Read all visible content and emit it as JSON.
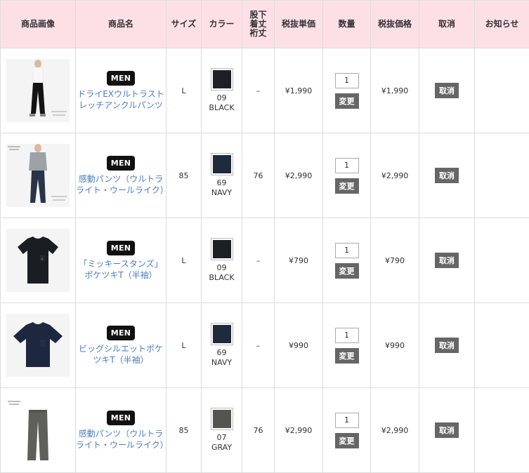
{
  "headers": {
    "image": "商品画像",
    "name": "商品名",
    "size": "サイズ",
    "color": "カラー",
    "inseam": "股下\n着丈\n裄丈",
    "unit_price": "税抜単価",
    "quantity": "数量",
    "price": "税抜価格",
    "cancel": "取消",
    "notice": "お知らせ"
  },
  "labels": {
    "men_badge": "MEN",
    "change_button": "変更",
    "cancel_button": "取消"
  },
  "items": [
    {
      "badge": "MEN",
      "name": "ドライEXウルトラストレッチアンクルパンツ",
      "size": "L",
      "color_code": "09",
      "color_name": "BLACK",
      "swatch_color": "#1d2023",
      "inseam": "–",
      "unit_price": "¥1,990",
      "quantity": "1",
      "price": "¥1,990",
      "image_type": "pants-black"
    },
    {
      "badge": "MEN",
      "name": "感動パンツ（ウルトラライト・ウールライク）",
      "size": "85",
      "color_code": "69",
      "color_name": "NAVY",
      "swatch_color": "#1f2a3d",
      "inseam": "76",
      "unit_price": "¥2,990",
      "quantity": "1",
      "price": "¥2,990",
      "image_type": "pants-navy-model"
    },
    {
      "badge": "MEN",
      "name": "「ミッキースタンズ」ポケツキT（半袖）",
      "size": "L",
      "color_code": "09",
      "color_name": "BLACK",
      "swatch_color": "#1d2023",
      "inseam": "–",
      "unit_price": "¥790",
      "quantity": "1",
      "price": "¥790",
      "image_type": "tshirt-black"
    },
    {
      "badge": "MEN",
      "name": "ビッグシルエットポケツキT（半袖）",
      "size": "L",
      "color_code": "69",
      "color_name": "NAVY",
      "swatch_color": "#1f2a3d",
      "inseam": "–",
      "unit_price": "¥990",
      "quantity": "1",
      "price": "¥990",
      "image_type": "tshirt-navy"
    },
    {
      "badge": "MEN",
      "name": "感動パンツ（ウルトラライト・ウールライク）",
      "size": "85",
      "color_code": "07",
      "color_name": "GRAY",
      "swatch_color": "#555550",
      "inseam": "76",
      "unit_price": "¥2,990",
      "quantity": "1",
      "price": "¥2,990",
      "image_type": "pants-gray"
    }
  ]
}
